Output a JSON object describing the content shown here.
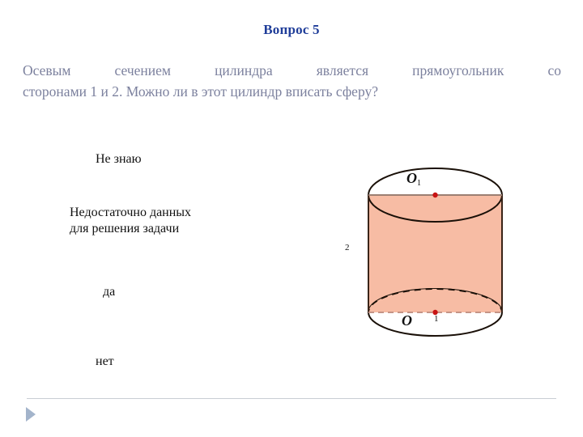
{
  "slide": {
    "title": "Вопрос 5",
    "title_color": "#1F3D99",
    "background": "#ffffff",
    "question_line1": "Осевым сечением цилиндра является прямоугольник со",
    "question_line2": "сторонами 1 и 2. Можно ли в этот цилиндр вписать сферу?",
    "question_color": "#7C819E"
  },
  "options": [
    {
      "label": "Не знаю"
    },
    {
      "label": "Недостаточно данных\nдля решения задачи"
    },
    {
      "label": "да"
    },
    {
      "label": "нет"
    }
  ],
  "figure": {
    "name": "cylinder-diagram",
    "fill_color": "#F7BCA4",
    "stroke_color": "#1A1008",
    "point_color": "#C81414",
    "labels": {
      "top_center": "O",
      "top_center_sub": "1",
      "bottom_center": "O",
      "radius": "1",
      "height": "2"
    }
  },
  "footer": {
    "rule_color": "#C9CDD4",
    "next_arrow": "next-slide-arrow",
    "arrow_color": "#A3B4CB"
  }
}
